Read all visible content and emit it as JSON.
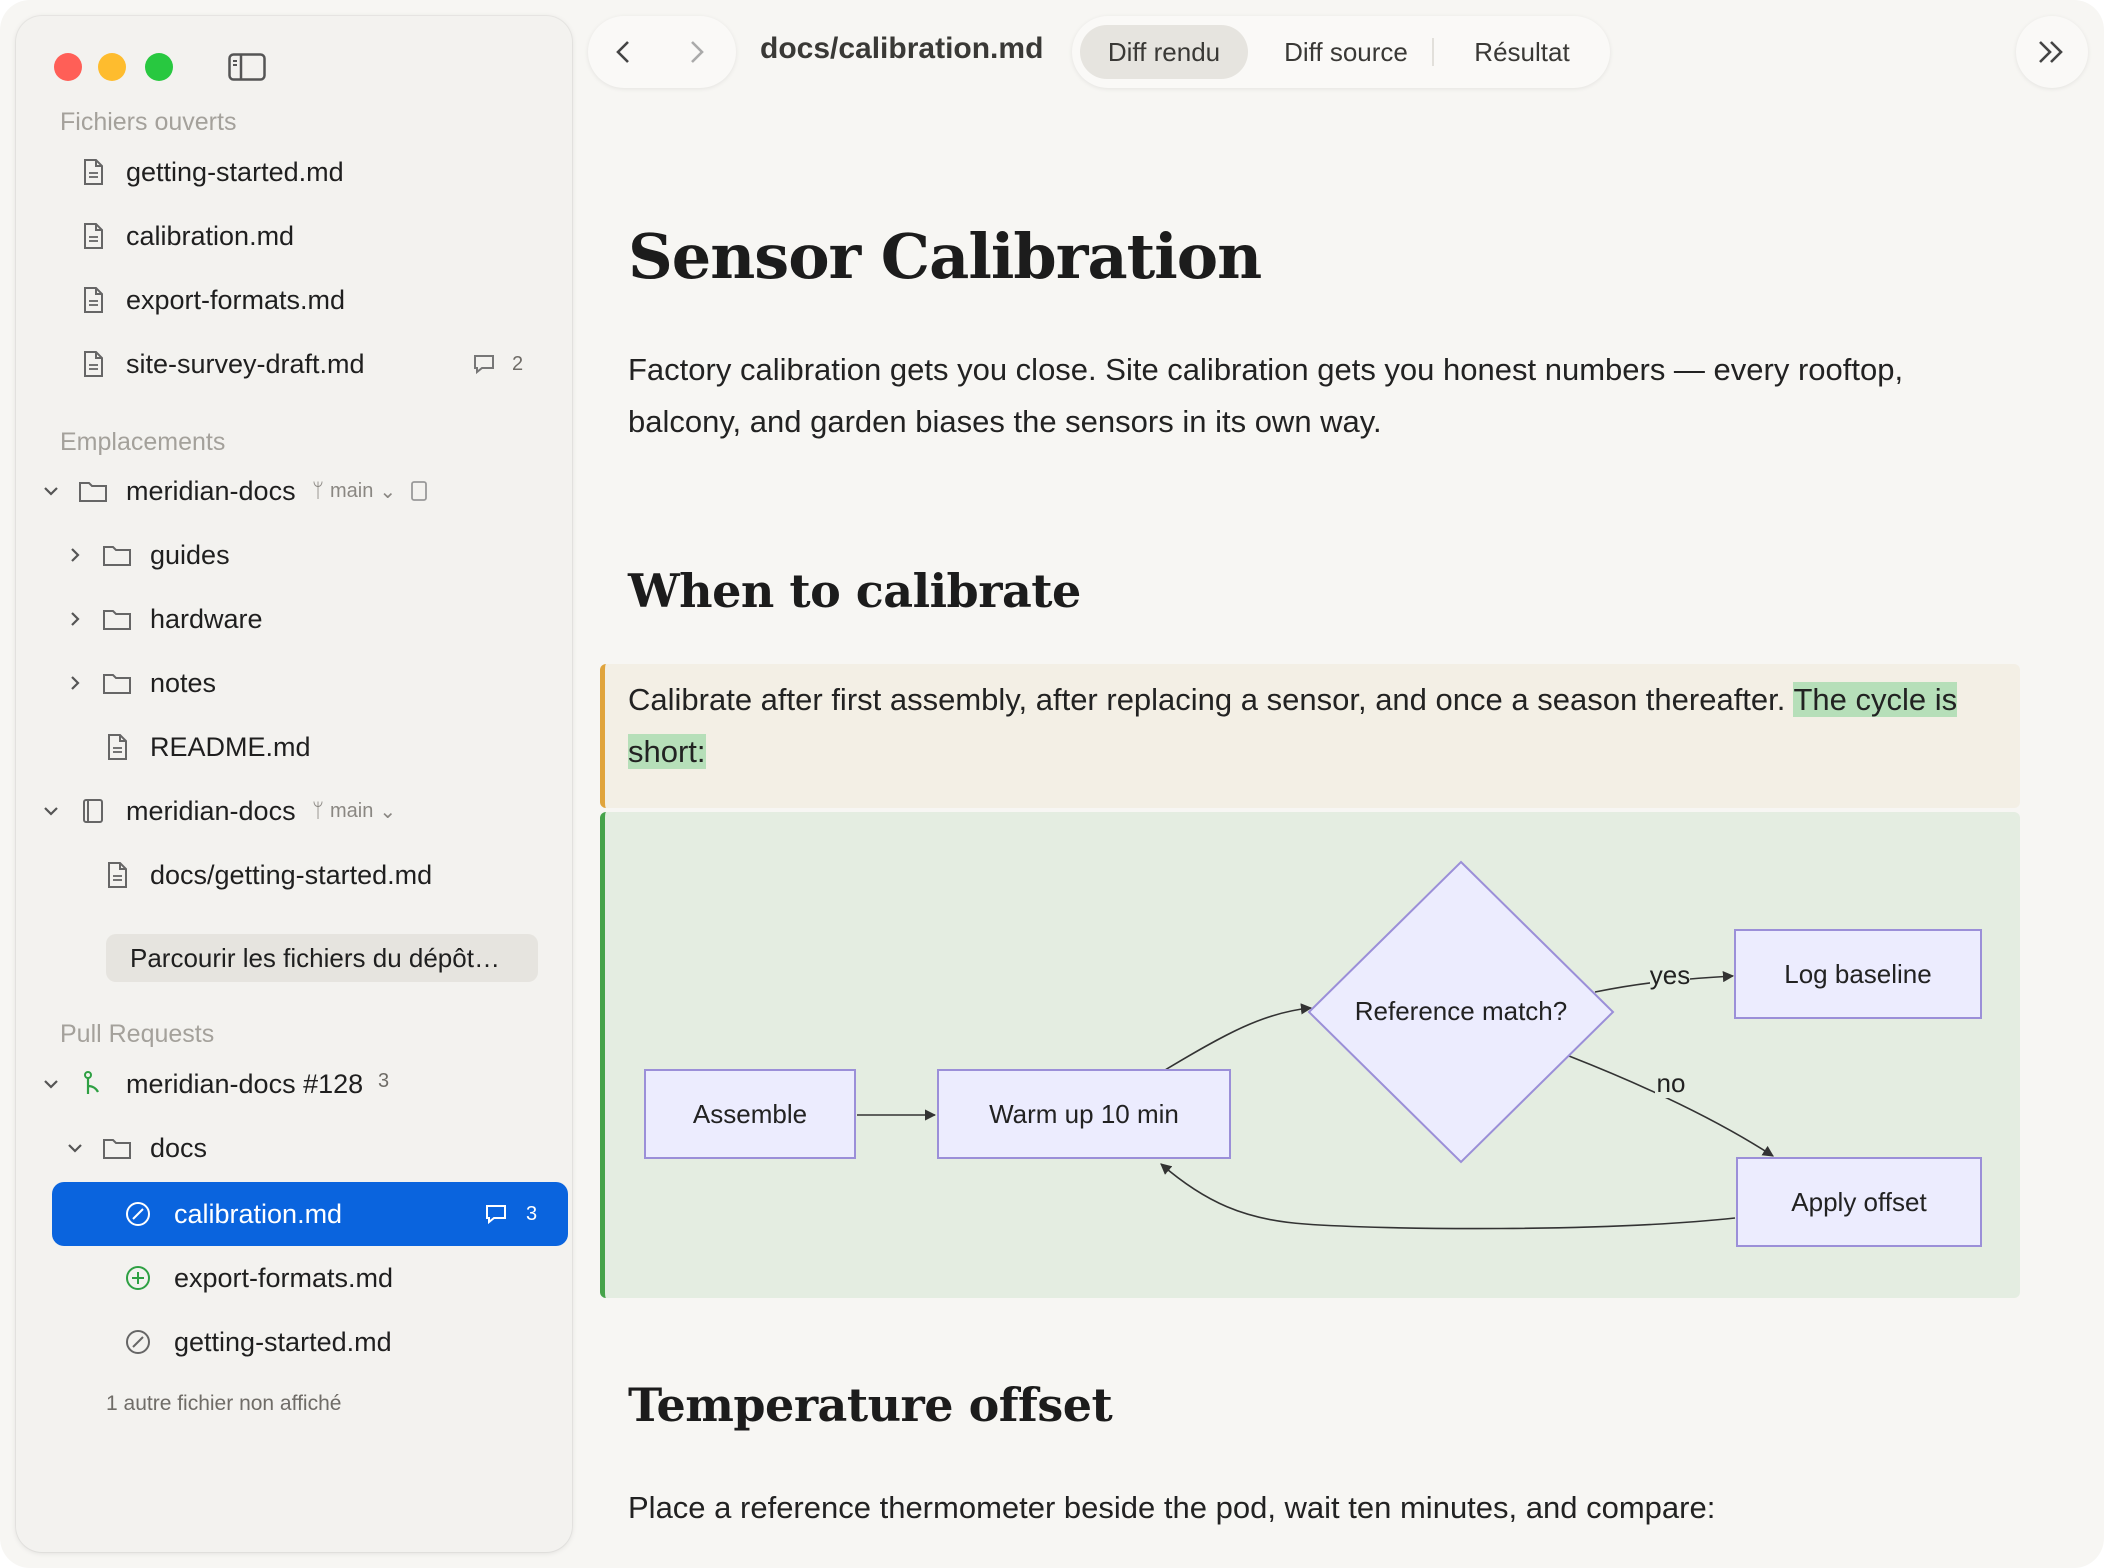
{
  "sidebar": {
    "open_files_label": "Fichiers ouverts",
    "open_files": [
      {
        "name": "getting-started.md"
      },
      {
        "name": "calibration.md"
      },
      {
        "name": "export-formats.md"
      },
      {
        "name": "site-survey-draft.md",
        "comments": "2"
      }
    ],
    "locations_label": "Emplacements",
    "repo1": {
      "name": "meridian-docs",
      "branch": "main"
    },
    "repo1_children": [
      {
        "name": "guides"
      },
      {
        "name": "hardware"
      },
      {
        "name": "notes"
      },
      {
        "name": "README.md"
      }
    ],
    "repo2": {
      "name": "meridian-docs",
      "branch": "main"
    },
    "repo2_children": [
      {
        "name": "docs/getting-started.md"
      }
    ],
    "browse_button": "Parcourir les fichiers du dépôt…",
    "pull_requests_label": "Pull Requests",
    "pr": {
      "name": "meridian-docs #128",
      "count": "3"
    },
    "pr_folder": "docs",
    "pr_files": [
      {
        "name": "calibration.md",
        "comments": "3",
        "status": "modified"
      },
      {
        "name": "export-formats.md",
        "status": "added"
      },
      {
        "name": "getting-started.md",
        "status": "modified"
      }
    ],
    "hidden_note": "1 autre fichier non affiché"
  },
  "toolbar": {
    "path": "docs/calibration.md",
    "tabs": [
      "Diff rendu",
      "Diff source",
      "Résultat"
    ],
    "active_tab": "Diff rendu"
  },
  "doc": {
    "title": "Sensor Calibration",
    "intro": "Factory calibration gets you close. Site calibration gets you honest numbers — every rooftop, balcony, and garden biases the sensors in its own way.",
    "h_when": "When to calibrate",
    "when_text": "Calibrate after first assembly, after replacing a sensor, and once a season thereafter.",
    "when_added": "The cycle is short:",
    "h_temp": "Temperature offset",
    "temp_text": "Place a reference thermometer beside the pod, wait ten minutes, and compare:"
  },
  "diagram": {
    "nodes": {
      "assemble": "Assemble",
      "warmup": "Warm up 10 min",
      "decision": "Reference match?",
      "log": "Log baseline",
      "apply": "Apply offset"
    },
    "edge_labels": {
      "yes": "yes",
      "no": "no"
    }
  },
  "colors": {
    "accent": "#0a64de",
    "changed_bar": "#e0a43c",
    "added_bar": "#46a34a",
    "added_bg": "#e4ede1",
    "changed_bg": "#f3efe5",
    "highlight": "#b6dfb9",
    "node_fill": "#ececfe",
    "node_stroke": "#9b8fd8"
  }
}
